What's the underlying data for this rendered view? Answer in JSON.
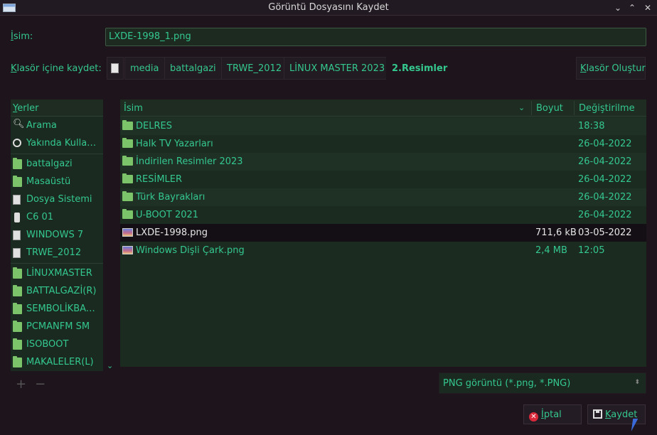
{
  "window": {
    "title": "Görüntü Dosyasını Kaydet",
    "min": "⌄",
    "max": "⌃",
    "close": "✕"
  },
  "name_field": {
    "label_u": "İ",
    "label_rest": "sim:",
    "value": "LXDE-1998_1.png"
  },
  "folder_row": {
    "label_u": "K",
    "label_rest": "lasör içine kaydet:",
    "crumbs": [
      "media",
      "battalgazi",
      "TRWE_2012",
      "LİNUX MASTER 2023",
      "2.Resimler"
    ],
    "new_folder_u": "K",
    "new_folder_rest": "lasör Oluştur"
  },
  "places": {
    "header_u": "Y",
    "header_rest": "erler",
    "items": [
      "Arama",
      "Yakında Kullanı...",
      "battalgazi",
      "Masaüstü",
      "Dosya Sistemi",
      "C6 01",
      "WINDOWS 7",
      "TRWE_2012",
      "LİNUXMASTER",
      "BATTALGAZİ(R)",
      "SEMBOLİKBAĞ...",
      "PCMANFM SM",
      "ISOBOOT",
      "MAKALELER(L)"
    ],
    "scroll_down": "⌄",
    "add": "+",
    "remove": "−"
  },
  "files": {
    "columns": {
      "name": "İsim",
      "sort": "⌄",
      "size": "Boyut",
      "date": "Değiştirilme"
    },
    "rows": [
      {
        "name": "DELRES",
        "size": "",
        "date": "18:38",
        "icon": "folder-icon"
      },
      {
        "name": "Halk TV Yazarları",
        "size": "",
        "date": "26-04-2022",
        "icon": "folder-icon"
      },
      {
        "name": "İndirilen Resimler 2023",
        "size": "",
        "date": "26-04-2022",
        "icon": "folder-icon"
      },
      {
        "name": "RESİMLER",
        "size": "",
        "date": "26-04-2022",
        "icon": "folder-icon"
      },
      {
        "name": "Türk Bayrakları",
        "size": "",
        "date": "26-04-2022",
        "icon": "folder-icon"
      },
      {
        "name": "U-BOOT 2021",
        "size": "",
        "date": "26-04-2022",
        "icon": "folder-icon"
      },
      {
        "name": "LXDE-1998.png",
        "size": "711,6 kB",
        "date": "03-05-2022",
        "icon": "image-file-icon",
        "selected": true
      },
      {
        "name": "Windows Dişli Çark.png",
        "size": "2,4 MB",
        "date": "12:05",
        "icon": "image-file-icon"
      }
    ]
  },
  "filter": {
    "value": "PNG görüntü (*.png, *.PNG)",
    "arrow": "⬍"
  },
  "actions": {
    "cancel_u": "İ",
    "cancel_rest": "ptal",
    "save_u": "K",
    "save_rest": "aydet"
  }
}
